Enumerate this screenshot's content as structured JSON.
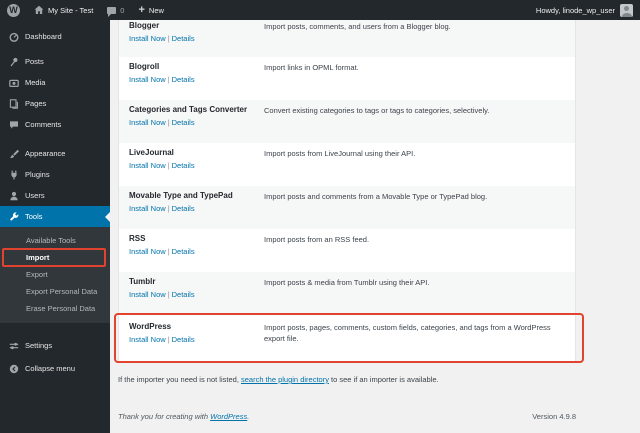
{
  "admin_bar": {
    "wp_logo": "W",
    "site_name": "My Site - Test",
    "comments_count": "0",
    "new_plus": "+",
    "new_label": "New",
    "howdy": "Howdy, linode_wp_user"
  },
  "sidebar": {
    "items": [
      "Dashboard",
      "Posts",
      "Media",
      "Pages",
      "Comments",
      "Appearance",
      "Plugins",
      "Users",
      "Tools",
      "Settings",
      "Collapse menu"
    ],
    "submenu": [
      "Available Tools",
      "Import",
      "Export",
      "Export Personal Data",
      "Erase Personal Data"
    ]
  },
  "importers": {
    "install_label": "Install Now",
    "details_label": "Details",
    "separator": "|",
    "rows": [
      {
        "name": "Blogger",
        "description": "Import posts, comments, and users from a Blogger blog."
      },
      {
        "name": "Blogroll",
        "description": "Import links in OPML format."
      },
      {
        "name": "Categories and Tags Converter",
        "description": "Convert existing categories to tags or tags to categories, selectively."
      },
      {
        "name": "LiveJournal",
        "description": "Import posts from LiveJournal using their API."
      },
      {
        "name": "Movable Type and TypePad",
        "description": "Import posts and comments from a Movable Type or TypePad blog."
      },
      {
        "name": "RSS",
        "description": "Import posts from an RSS feed."
      },
      {
        "name": "Tumblr",
        "description": "Import posts & media from Tumblr using their API."
      },
      {
        "name": "WordPress",
        "description": "Import posts, pages, comments, custom fields, categories, and tags from a WordPress export file."
      }
    ]
  },
  "note": {
    "prefix": "If the importer you need is not listed, ",
    "link": "search the plugin directory",
    "suffix": " to see if an importer is available."
  },
  "footer": {
    "thanks_prefix": "Thank you for creating with ",
    "thanks_link": "WordPress",
    "thanks_suffix": ".",
    "version": "Version 4.9.8"
  },
  "colors": {
    "admin_bar_bg": "#23282d",
    "submenu_bg": "#32373c",
    "active_blue": "#0073aa",
    "link_blue": "#0073aa",
    "annotation_red": "#e2432e",
    "content_bg": "#f1f1f1",
    "row_stripe": "#f6f7f7"
  }
}
